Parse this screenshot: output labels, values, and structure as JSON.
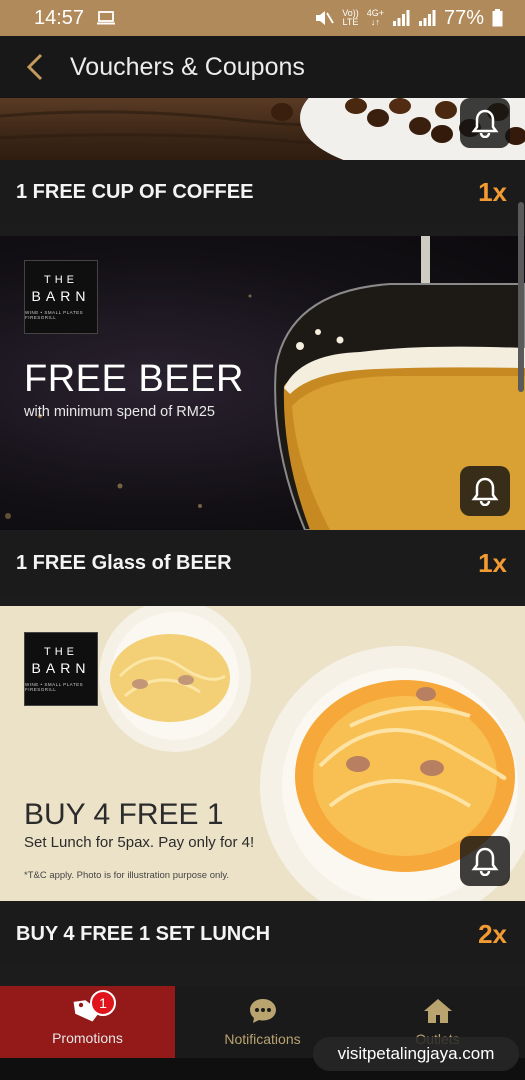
{
  "status_bar": {
    "time": "14:57",
    "volte_top": "Vo))",
    "volte_bottom": "LTE",
    "network_top": "4G+",
    "network_bottom": "↓↑",
    "battery_text": "77%"
  },
  "header": {
    "title": "Vouchers & Coupons"
  },
  "vouchers": [
    {
      "title": "1 FREE CUP OF COFFEE",
      "quantity": "1x"
    },
    {
      "title": "1 FREE Glass of BEER",
      "quantity": "1x",
      "banner": {
        "logo_the": "THE",
        "logo_barn": "BARN",
        "logo_sub": "WINE • SMALL PLATES  FIRESGRILL",
        "headline": "FREE BEER",
        "subtext": "with minimum spend of RM25"
      }
    },
    {
      "title": "BUY 4 FREE 1 SET LUNCH",
      "quantity": "2x",
      "banner": {
        "logo_the": "THE",
        "logo_barn": "BARN",
        "logo_sub": "WINE • SMALL PLATES  FIRESGRILL",
        "headline": "BUY 4 FREE 1",
        "subtext": "Set Lunch for 5pax. Pay only for 4!",
        "note": "*T&C apply. Photo is for illustration purpose only."
      }
    }
  ],
  "bottom_nav": {
    "items": [
      {
        "label": "Promotions",
        "icon": "tag-icon",
        "active": true,
        "badge": "1"
      },
      {
        "label": "Notifications",
        "icon": "chat-bubble-icon",
        "active": false
      },
      {
        "label": "Outlets",
        "icon": "home-icon",
        "active": false
      }
    ]
  },
  "watermark": "visitpetalingjaya.com",
  "colors": {
    "status_bar": "#b08a5a",
    "accent_quantity": "#f29b33",
    "active_tab": "#931a18",
    "badge": "#e0141c"
  }
}
